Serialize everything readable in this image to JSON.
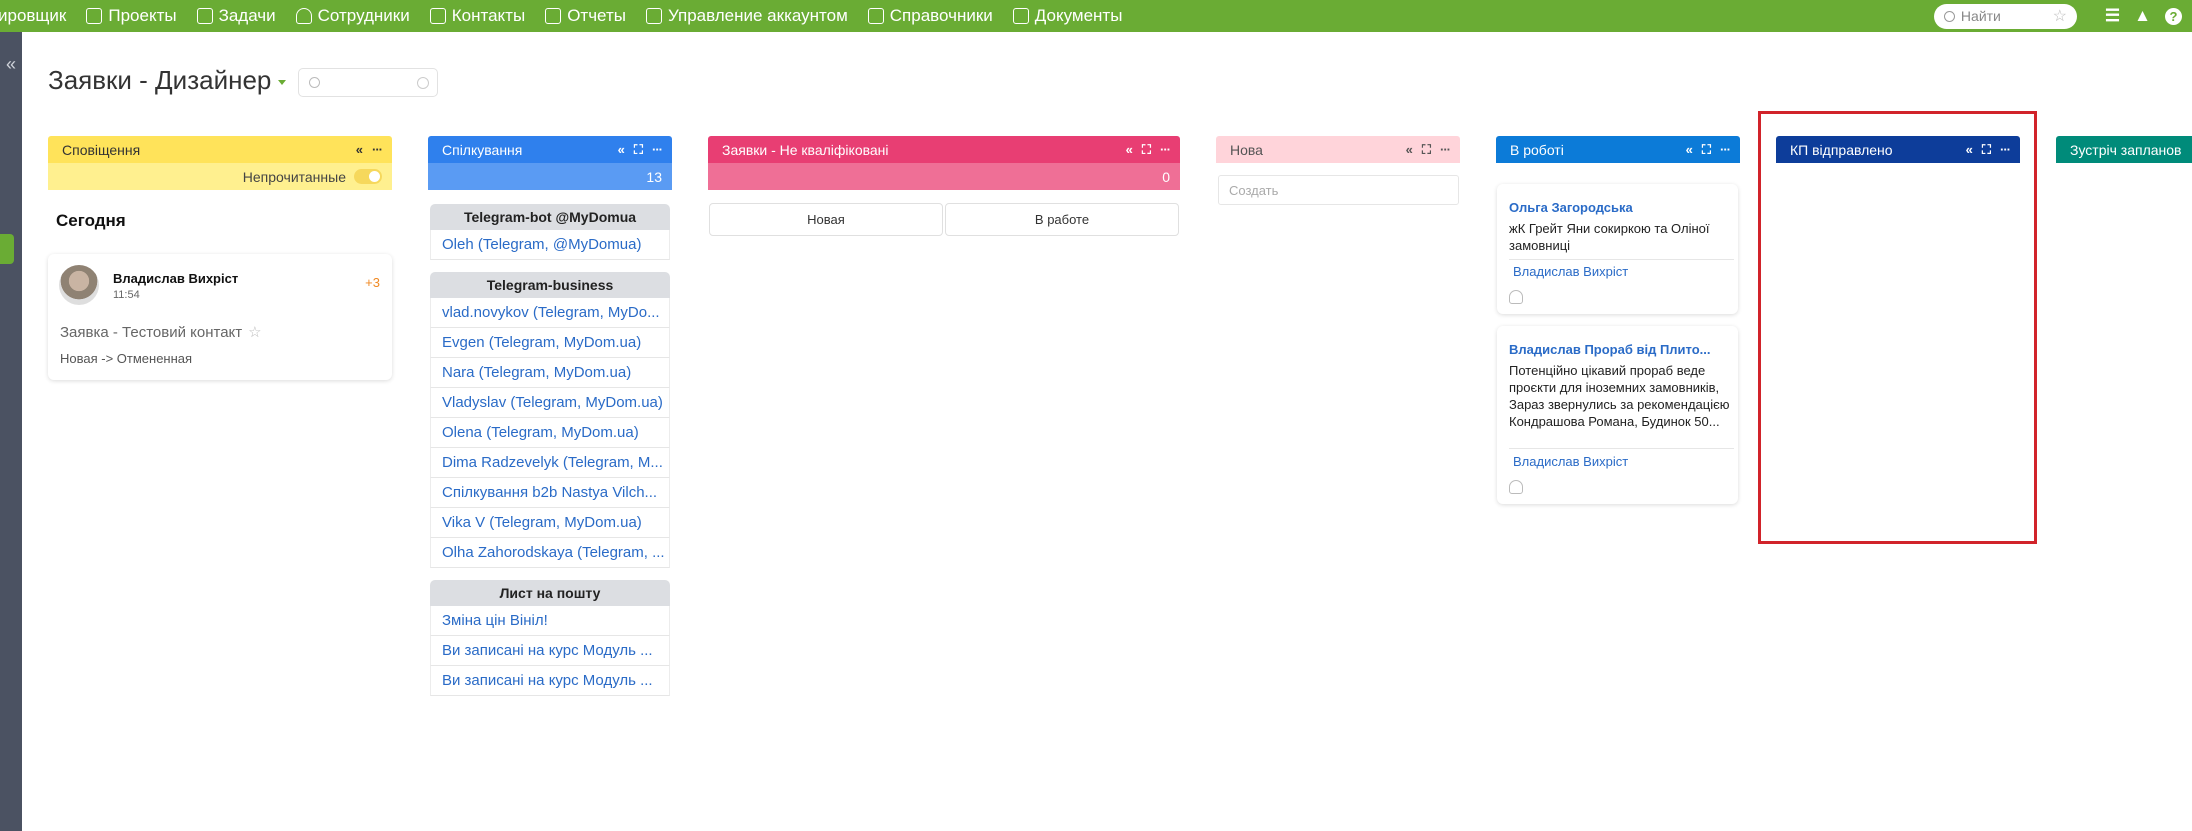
{
  "nav": {
    "items": [
      {
        "label": "ировщик"
      },
      {
        "label": "Проекты"
      },
      {
        "label": "Задачи"
      },
      {
        "label": "Сотрудники"
      },
      {
        "label": "Контакты"
      },
      {
        "label": "Отчеты"
      },
      {
        "label": "Управление аккаунтом"
      },
      {
        "label": "Справочники"
      },
      {
        "label": "Документы"
      }
    ],
    "search_placeholder": "Найти",
    "help_label": "?"
  },
  "page": {
    "title": "Заявки - Дизайнер"
  },
  "columns": {
    "notifications": {
      "title": "Сповіщення",
      "unread_label": "Непрочитанные",
      "today_label": "Сегодня",
      "card": {
        "name": "Владислав Вихріст",
        "time": "11:54",
        "extra": "+3",
        "lead": "Заявка - Тестовий контакт",
        "status": "Новая -> Отмененная"
      }
    },
    "chats": {
      "title": "Спілкування",
      "count": "13",
      "groups": [
        {
          "title": "Telegram-bot @MyDomua",
          "items": [
            "Oleh (Telegram, @MyDomua)"
          ]
        },
        {
          "title": "Telegram-business",
          "items": [
            "vlad.novykov (Telegram, MyDo...",
            "Evgen (Telegram, MyDom.ua)",
            "Nara (Telegram, MyDom.ua)",
            "Vladyslav (Telegram, MyDom.ua)",
            "Olena (Telegram, MyDom.ua)",
            "Dima Radzevelyk (Telegram, M...",
            "Спілкування b2b Nastya Vilch...",
            "Vika V (Telegram, MyDom.ua)",
            "Olha Zahorodskaya (Telegram, ..."
          ]
        },
        {
          "title": "Лист на пошту",
          "items": [
            "Зміна цін Вініл!",
            "Ви записані на курс Модуль ...",
            "Ви записані на курс Модуль ..."
          ]
        }
      ]
    },
    "unqualified": {
      "title": "Заявки - Не кваліфіковані",
      "count": "0",
      "tabs": [
        "Новая",
        "В работе"
      ]
    },
    "new": {
      "title": "Нова",
      "create_placeholder": "Создать"
    },
    "in_progress": {
      "title": "В роботі",
      "cards": [
        {
          "title": "Ольга Загородська",
          "desc": "жК Грейт Яни сокиркою та Оліної замовниці",
          "owner": "Владислав Вихріст"
        },
        {
          "title": "Владислав Прораб від Плито...",
          "desc": "Потенційно цікавий прораб веде проєкти для іноземних замовників, Зараз звернулись за рекомендацією Кондрашова Романа, Будинок 50...",
          "owner": "Владислав Вихріст"
        }
      ]
    },
    "kp_sent": {
      "title": "КП відправлено"
    },
    "meeting": {
      "title": "Зустріч запланована"
    }
  },
  "colors": {
    "nav": "#6aac34",
    "notifications": "#ffe35a",
    "chats": "#2f80ed",
    "unqualified": "#e83e73",
    "new": "#ffd4da",
    "in_progress": "#0c7bd8",
    "kp_sent": "#0d3d9a",
    "meeting": "#008b7a",
    "highlight": "#d1232a"
  }
}
